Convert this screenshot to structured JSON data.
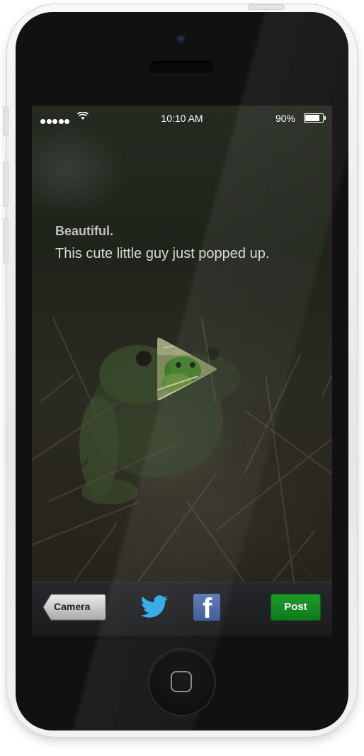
{
  "status_bar": {
    "time": "10:10 AM",
    "battery_percent": "90%",
    "battery_level": 0.9,
    "signal_bars": 5,
    "icons": [
      "signal-dots-icon",
      "wifi-icon",
      "battery-icon"
    ]
  },
  "post": {
    "title": "Beautiful.",
    "body": "This cute little guy just popped up.",
    "media_control": "play-icon"
  },
  "toolbar": {
    "camera_label": "Camera",
    "share_icons": [
      "twitter-icon",
      "facebook-icon"
    ],
    "facebook_glyph": "f",
    "post_label": "Post"
  },
  "colors": {
    "post_button": "#15861f",
    "facebook": "#3b5998",
    "twitter": "#2ea8e8"
  }
}
